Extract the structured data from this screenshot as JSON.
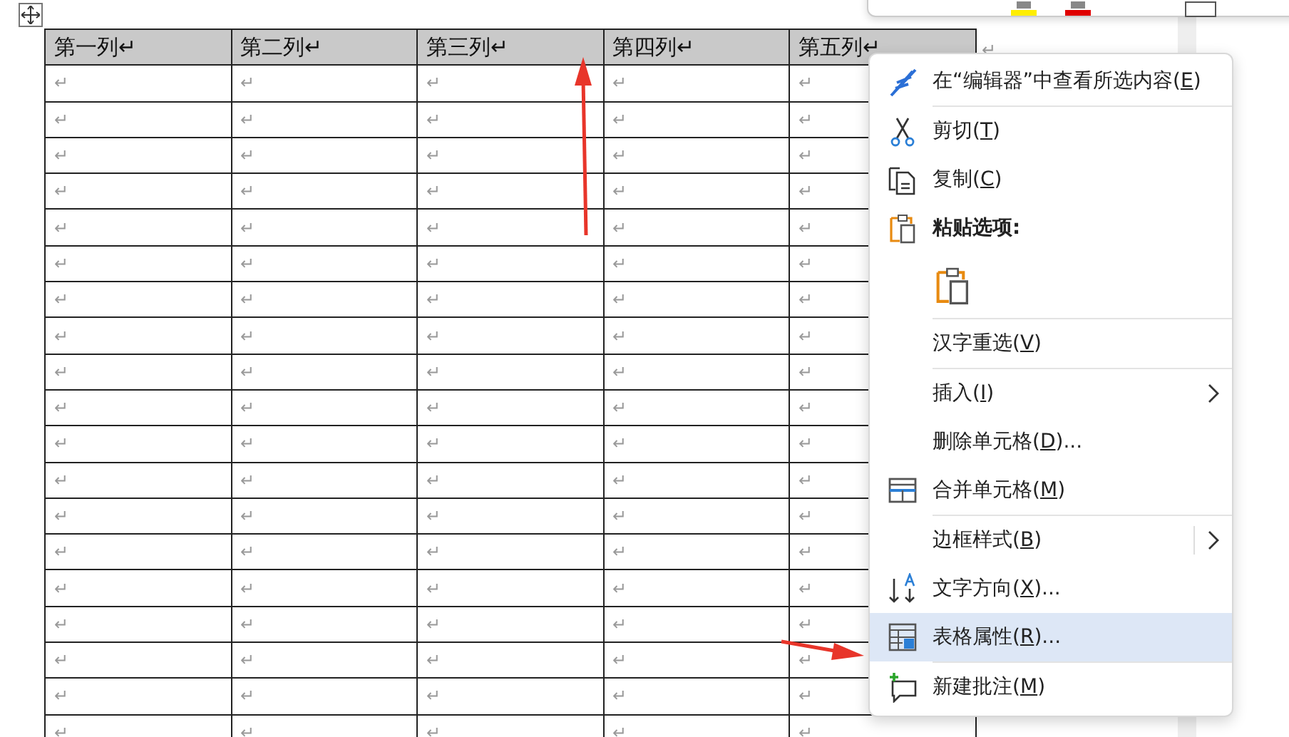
{
  "table": {
    "columns": [
      "第一列↵",
      "第二列↵",
      "第三列↵",
      "第四列↵",
      "第五列↵"
    ],
    "row_end_mark": "↵",
    "rows": [
      [
        "↵",
        "↵",
        "↵",
        "↵",
        "↵"
      ],
      [
        "↵",
        "↵",
        "↵",
        "↵",
        "↵"
      ],
      [
        "↵",
        "↵",
        "↵",
        "↵",
        "↵"
      ],
      [
        "↵",
        "↵",
        "↵",
        "↵",
        "↵"
      ],
      [
        "↵",
        "↵",
        "↵",
        "↵",
        "↵"
      ],
      [
        "↵",
        "↵",
        "↵",
        "↵",
        "↵"
      ],
      [
        "↵",
        "↵",
        "↵",
        "↵",
        "↵"
      ],
      [
        "↵",
        "↵",
        "↵",
        "↵",
        "↵"
      ],
      [
        "↵",
        "↵",
        "↵",
        "↵",
        "↵"
      ],
      [
        "↵",
        "↵",
        "↵",
        "↵",
        "↵"
      ],
      [
        "↵",
        "↵",
        "↵",
        "↵",
        "↵"
      ],
      [
        "↵",
        "↵",
        "↵",
        "↵",
        "↵"
      ],
      [
        "↵",
        "↵",
        "↵",
        "↵",
        "↵"
      ],
      [
        "↵",
        "↵",
        "↵",
        "↵",
        "↵"
      ],
      [
        "↵",
        "↵",
        "↵",
        "↵",
        "↵"
      ],
      [
        "↵",
        "↵",
        "↵",
        "↵",
        "↵"
      ],
      [
        "↵",
        "↵",
        "↵",
        "↵",
        "↵"
      ],
      [
        "↵",
        "↵",
        "↵",
        "↵",
        "↵"
      ],
      [
        "↵",
        "↵",
        "↵",
        "↵",
        "↵"
      ]
    ]
  },
  "context_menu": {
    "items": [
      {
        "kind": "editor",
        "label": "在“编辑器”中查看所选内容(",
        "accel": "E",
        "suffix": ")",
        "selected": false,
        "submenu": false,
        "separator_after": true
      },
      {
        "kind": "cut",
        "label": "剪切(",
        "accel": "T",
        "suffix": ")",
        "selected": false,
        "submenu": false,
        "separator_after": false
      },
      {
        "kind": "copy",
        "label": "复制(",
        "accel": "C",
        "suffix": ")",
        "selected": false,
        "submenu": false,
        "separator_after": false
      },
      {
        "kind": "heading",
        "label": "粘贴选项:",
        "selected": false,
        "submenu": false,
        "separator_after": false
      },
      {
        "kind": "paste",
        "selected": false,
        "separator_after": true
      },
      {
        "kind": "plain",
        "label": "汉字重选(",
        "accel": "V",
        "suffix": ")",
        "selected": false,
        "submenu": false,
        "separator_after": true
      },
      {
        "kind": "plain",
        "label": "插入(",
        "accel": "I",
        "suffix": ")",
        "selected": false,
        "submenu": true,
        "separator_after": false
      },
      {
        "kind": "plain",
        "label": "删除单元格(",
        "accel": "D",
        "suffix": ")...",
        "selected": false,
        "submenu": false,
        "separator_after": false
      },
      {
        "kind": "merge",
        "label": "合并单元格(",
        "accel": "M",
        "suffix": ")",
        "selected": false,
        "submenu": false,
        "separator_after": true
      },
      {
        "kind": "split",
        "label": "边框样式(",
        "accel": "B",
        "suffix": ")",
        "selected": false,
        "submenu": true,
        "separator_after": false
      },
      {
        "kind": "direction",
        "label": "文字方向(",
        "accel": "X",
        "suffix": ")...",
        "selected": false,
        "submenu": false,
        "separator_after": false
      },
      {
        "kind": "properties",
        "label": "表格属性(",
        "accel": "R",
        "suffix": ")...",
        "selected": true,
        "submenu": false,
        "separator_after": true
      },
      {
        "kind": "comment",
        "label": "新建批注(",
        "accel": "M",
        "suffix": ")",
        "selected": false,
        "submenu": false,
        "separator_after": false
      }
    ]
  }
}
